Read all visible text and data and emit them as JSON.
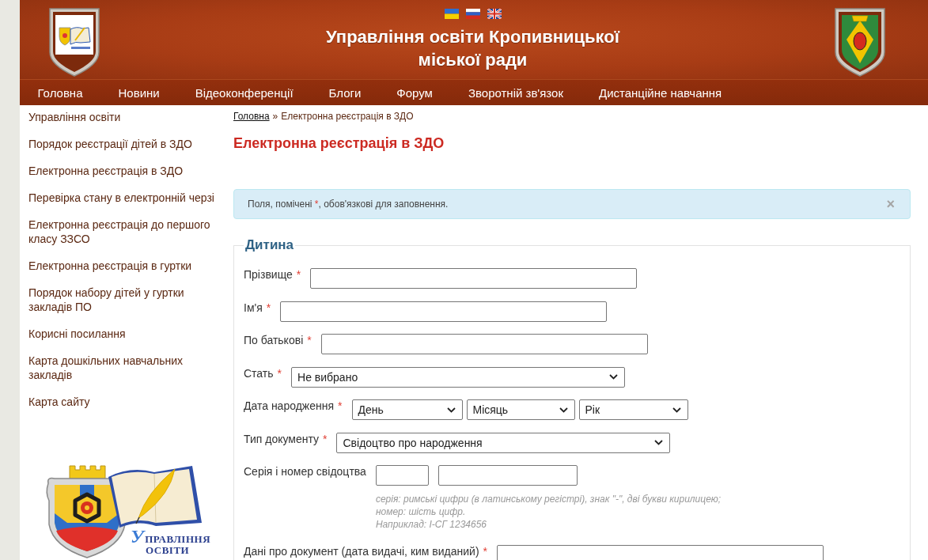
{
  "header": {
    "title": "Управління освіти Кропивницької міської ради"
  },
  "nav": {
    "items": [
      "Головна",
      "Новини",
      "Відеоконференції",
      "Блоги",
      "Форум",
      "Зворотній зв'язок",
      "Дистанційне навчання"
    ]
  },
  "sidebar": {
    "items": [
      "Управління освіти",
      "Порядок реєстрації дітей в ЗДО",
      "Електронна реєстрація в ЗДО",
      "Перевірка стану в електронній черзі",
      "Електронна реєстрація до першого класу ЗЗСО",
      "Електронна реєстрація в гуртки",
      "Порядок набору дітей у гуртки закладів ПО",
      "Корисні посилання",
      "Карта дошкільних навчальних закладів",
      "Карта сайту"
    ],
    "logo_text": [
      "УПРАВЛІННЯ",
      "ОСВІТИ"
    ]
  },
  "breadcrumb": {
    "link": "Головна",
    "separator": "»",
    "current": "Електронна реєстрація в ЗДО"
  },
  "page_title": "Електронна реєстрація в ЗДО",
  "alert": {
    "before": "Поля, помічені ",
    "mark": "*",
    "after": ", обов'язкові для заповнення.",
    "close": "×"
  },
  "form": {
    "legend": "Дитина",
    "fields": [
      {
        "kind": "text",
        "label": "Прізвище",
        "required_mark": "*"
      },
      {
        "kind": "text",
        "label": "Ім'я",
        "required_mark": "*"
      },
      {
        "kind": "text",
        "label": "По батькові",
        "required_mark": "*"
      },
      {
        "kind": "select",
        "label": "Стать",
        "required_mark": "*",
        "value": "Не вибрано"
      },
      {
        "kind": "selects",
        "label": "Дата народження",
        "required_mark": "*",
        "values": [
          "День",
          "Місяць",
          "Рік"
        ]
      },
      {
        "kind": "select",
        "label": "Тип документу",
        "required_mark": "*",
        "value": "Свідоцтво про народження"
      },
      {
        "kind": "pair",
        "label": "Серія і номер свідоцтва",
        "hint": [
          "серія: римські цифри (в латинському регістрі), знак \"-\", дві букви кирилицею;",
          "номер: шість цифр.",
          "Наприклад: I-СГ 1234656"
        ]
      },
      {
        "kind": "text",
        "label": "Дані про документ (дата видачі, ким виданий)",
        "required_mark": "*"
      }
    ]
  }
}
